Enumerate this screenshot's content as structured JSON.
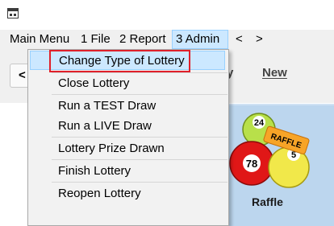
{
  "menubar": {
    "items": [
      {
        "label": "Main Menu"
      },
      {
        "label": "1 File"
      },
      {
        "label": "2 Report"
      },
      {
        "label": "3 Admin"
      },
      {
        "label": "<"
      },
      {
        "label": ">"
      }
    ]
  },
  "toolbar": {
    "back_label": "<",
    "partial_label": "y",
    "new_label": "New"
  },
  "admin_menu": {
    "items": [
      {
        "label": "Change Type of Lottery"
      },
      {
        "label": "Close Lottery"
      },
      {
        "label": "Run a TEST Draw"
      },
      {
        "label": "Run a LIVE Draw"
      },
      {
        "label": "Lottery Prize Drawn"
      },
      {
        "label": "Finish Lottery"
      },
      {
        "label": "Reopen Lottery"
      }
    ]
  },
  "tile": {
    "label": "Raffle",
    "ball_numbers": [
      "24",
      "78",
      "5"
    ],
    "ticket_text": "RAFFLE"
  },
  "colors": {
    "menu_highlight": "#cce8ff",
    "selection_outline": "#e0202a",
    "tile_background": "#bcd6ee"
  }
}
